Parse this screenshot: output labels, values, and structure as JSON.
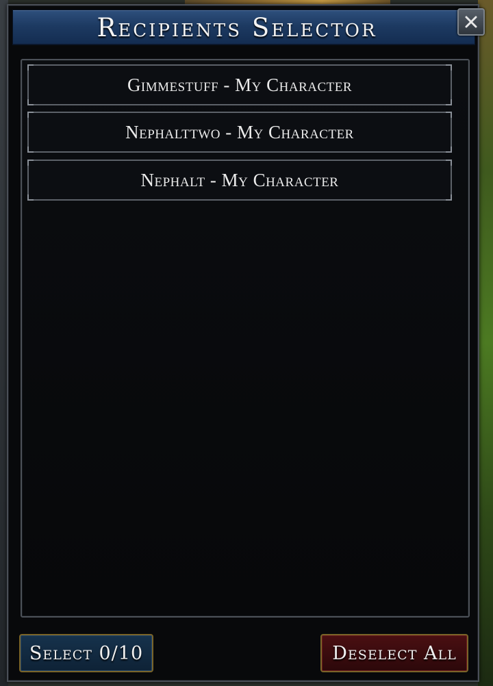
{
  "window": {
    "title": "Recipients Selector"
  },
  "recipients": [
    {
      "label": "Gimmestuff - My Character"
    },
    {
      "label": "Nephalttwo - My Character"
    },
    {
      "label": "Nephalt - My Character"
    }
  ],
  "footer": {
    "select_label": "Select 0/10",
    "deselect_label": "Deselect All"
  },
  "icons": {
    "close": "close-icon"
  },
  "colors": {
    "titlebar": "#1d3a62",
    "select_button": "#16324c",
    "deselect_button": "#4a0f12",
    "button_border": "#7a6428"
  }
}
